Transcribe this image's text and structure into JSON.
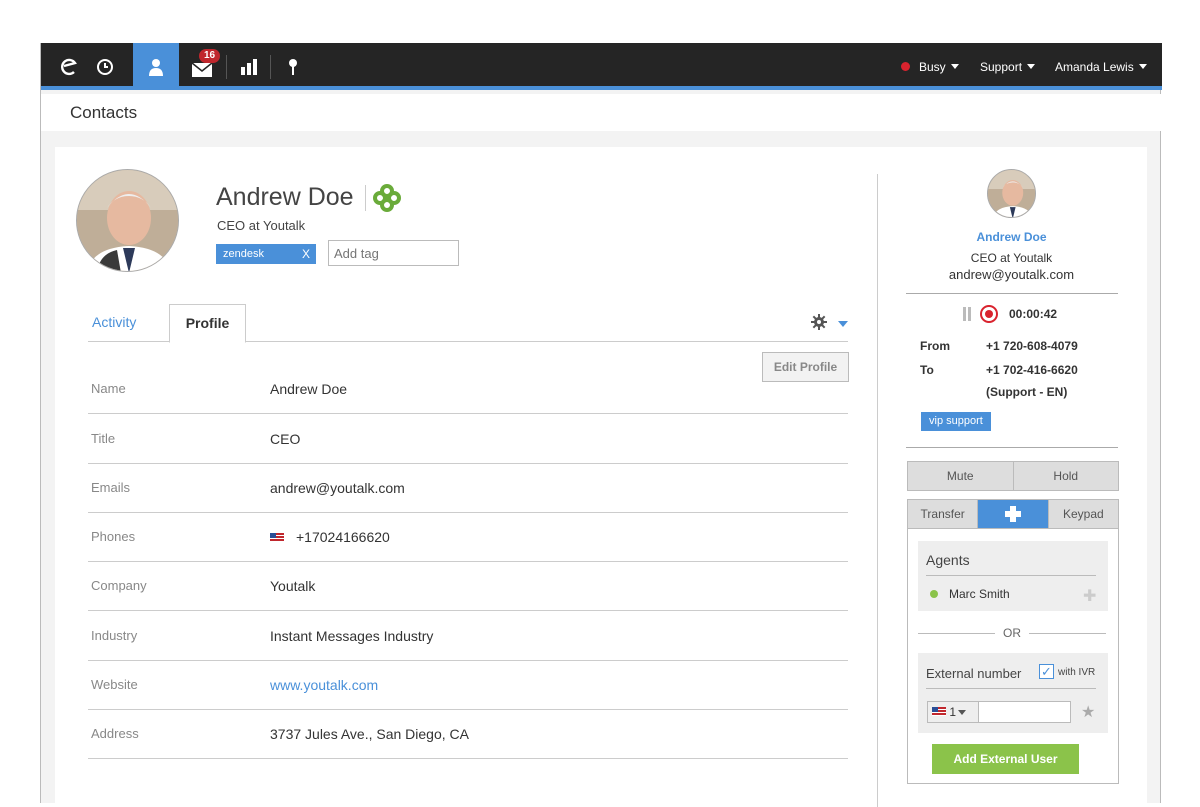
{
  "topbar": {
    "mail_badge": "16",
    "status_label": "Busy",
    "status_color": "#d9232e",
    "team_label": "Support",
    "user_label": "Amanda Lewis",
    "icons": [
      "logo-icon",
      "clock-icon",
      "contacts-icon",
      "mail-icon",
      "stats-icon",
      "pin-icon"
    ],
    "accent_color": "#4a90d9"
  },
  "page": {
    "title": "Contacts"
  },
  "contact": {
    "name": "Andrew Doe",
    "subtitle": "CEO at Youtalk",
    "tag": "zendesk",
    "tag_remove": "X",
    "tag_placeholder": "Add tag"
  },
  "tabs": {
    "activity": "Activity",
    "profile": "Profile"
  },
  "edit_profile": "Edit Profile",
  "profile_rows": [
    {
      "label": "Name",
      "value": "Andrew Doe"
    },
    {
      "label": "Title",
      "value": "CEO"
    },
    {
      "label": "Emails",
      "value": "andrew@youtalk.com"
    },
    {
      "label": "Phones",
      "value": "+17024166620"
    },
    {
      "label": "Company",
      "value": "Youtalk"
    },
    {
      "label": "Industry",
      "value": "Instant Messages Industry"
    },
    {
      "label": "Website",
      "value": "www.youtalk.com"
    },
    {
      "label": "Address",
      "value": "3737 Jules Ave., San Diego, CA"
    }
  ],
  "call": {
    "name": "Andrew Doe",
    "subtitle": "CEO at Youtalk",
    "email": "andrew@youtalk.com",
    "timer": "00:00:42",
    "from_label": "From",
    "from_value": "+1 720-608-4079",
    "to_label": "To",
    "to_value": "+1 702-416-6620",
    "to_note": "(Support - EN)",
    "vip_tag": "vip support",
    "mute": "Mute",
    "hold": "Hold",
    "transfer": "Transfer",
    "keypad": "Keypad",
    "agents_heading": "Agents",
    "agent_name": "Marc Smith",
    "or_label": "OR",
    "external_heading": "External number",
    "with_ivr": "with IVR",
    "country_code": "1",
    "add_external": "Add External User"
  }
}
